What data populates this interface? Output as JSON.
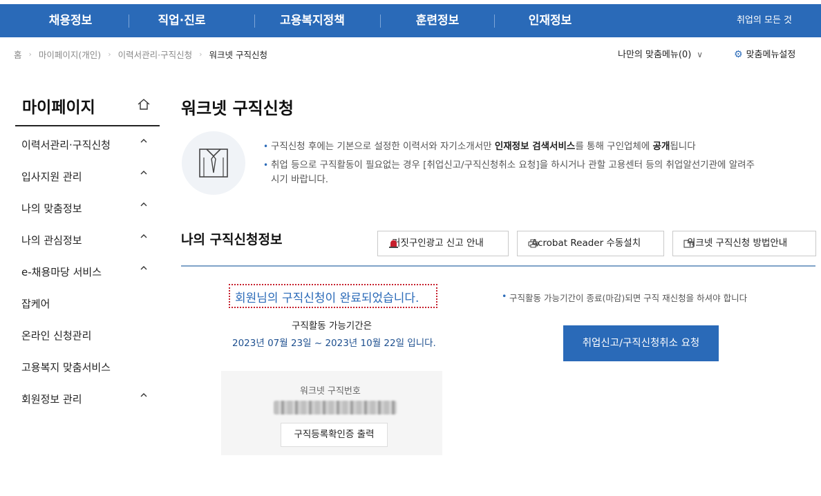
{
  "topnav": {
    "items": [
      "채용정보",
      "직업·진로",
      "고용복지정책",
      "훈련정보",
      "인재정보"
    ],
    "right": "취업의 모든 것"
  },
  "breadcrumb": {
    "items": [
      "홈",
      "마이페이지(개인)",
      "이력서관리·구직신청",
      "워크넷 구직신청"
    ],
    "my_menu": "나만의 맞춤메뉴(0)",
    "menu_settings": "맞춤메뉴설정"
  },
  "sidebar": {
    "title": "마이페이지",
    "items": [
      {
        "label": "이력서관리·구직신청"
      },
      {
        "label": "입사지원 관리"
      },
      {
        "label": "나의 맞춤정보"
      },
      {
        "label": "나의 관심정보"
      },
      {
        "label": "e-채용마당 서비스"
      },
      {
        "label": "잡케어"
      },
      {
        "label": "온라인 신청관리"
      },
      {
        "label": "고용복지 맞춤서비스"
      },
      {
        "label": "회원정보 관리"
      }
    ]
  },
  "main": {
    "title": "워크넷 구직신청",
    "notice1_a": "구직신청 후에는 기본으로 설정한 이력서와 자기소개서만 ",
    "notice1_b": "인재정보 검색서비스",
    "notice1_c": "를 통해 구인업체에 ",
    "notice1_d": "공개",
    "notice1_e": "됩니다",
    "notice2_line1": "취업 등으로 구직활동이 필요없는 경우 [취업신고/구직신청취소 요청]을 하시거나 관할 고용센터 등의 취업알선기관에 알려주",
    "notice2_line2": "시기 바랍니다.",
    "section_title": "나의 구직신청정보",
    "buttons": {
      "fake_ad": "거짓구인광고 신고 안내",
      "acrobat": "Acrobat Reader 수동설치",
      "howto": "워크넷 구직신청 방법안내"
    },
    "status": {
      "done_text": "회원님의 구직신청이 완료되었습니다.",
      "period_label": "구직활동 가능기간은",
      "period_value": "2023년 07월 23일 ~ 2023년 10월 22일 입니다."
    },
    "card": {
      "number_label": "워크넷 구직번호",
      "print_button": "구직등록확인증 출력"
    },
    "right_note": "구직활동 가능기간이 종료(마감)되면 구직 재신청을 하셔야 합니다",
    "cancel_button": "취업신고/구직신청취소 요청"
  },
  "colors": {
    "brand": "#2a6ab8",
    "alert": "#c61f2c"
  }
}
